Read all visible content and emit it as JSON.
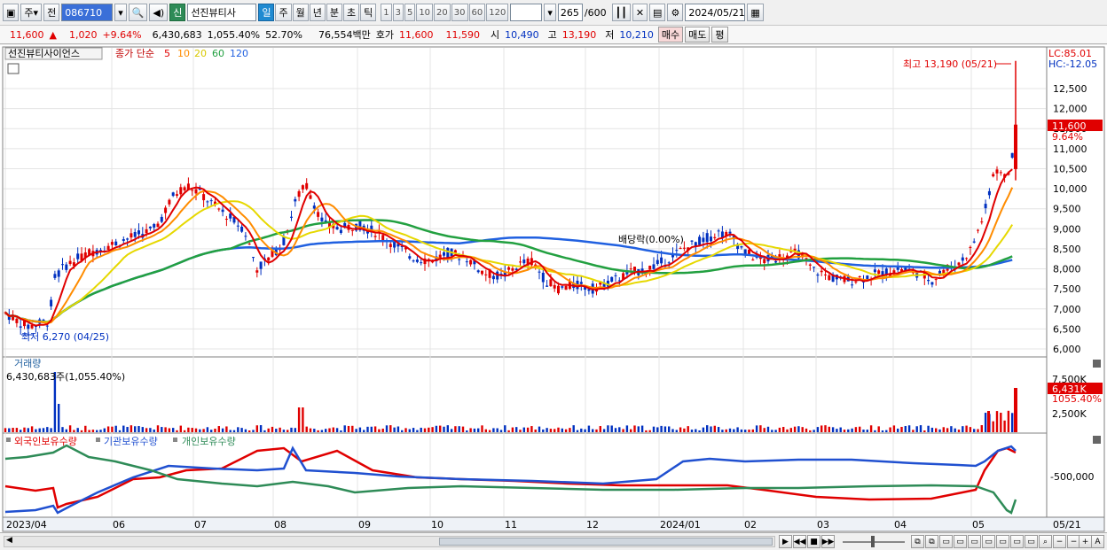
{
  "toolbar": {
    "market_type": "주",
    "prev_label": "전",
    "stock_code": "086710",
    "badge": "신",
    "stock_name": "선진뷰티사",
    "periods": [
      "일",
      "주",
      "월",
      "년",
      "분",
      "초",
      "틱"
    ],
    "active_period": "일",
    "intervals": [
      "1",
      "3",
      "5",
      "10",
      "20",
      "30",
      "60",
      "120"
    ],
    "count_value": "265",
    "count_total": "/600",
    "date_value": "2024/05/21"
  },
  "quote": {
    "price": "11,600",
    "arrow": "▲",
    "change": "1,020",
    "change_pct": "+9.64%",
    "volume": "6,430,683",
    "volume_pct": "1,055.40%",
    "turnover": "52.70%",
    "amount": "76,554백만",
    "ask_label": "호가",
    "ask": "11,600",
    "bid": "11,590",
    "open_label": "시",
    "open": "10,490",
    "high_label": "고",
    "high": "13,190",
    "low_label": "저",
    "low": "10,210",
    "buy_label": "매수",
    "sell_label": "매도",
    "eval_label": "평"
  },
  "price_panel": {
    "stock_title": "선진뷰티사이언스",
    "ma_title": "종가 단순",
    "ma_periods": [
      {
        "label": "5",
        "color": "#e00000"
      },
      {
        "label": "10",
        "color": "#ff8c00"
      },
      {
        "label": "20",
        "color": "#e6d800"
      },
      {
        "label": "60",
        "color": "#22a040"
      },
      {
        "label": "120",
        "color": "#2060e0"
      }
    ],
    "lc_label": "LC:85.01",
    "hc_label": "HC:-12.05",
    "high_annotation": "최고 13,190 (05/21)",
    "low_annotation": "최저 6,270 (04/25)",
    "dividend_annotation": "배당락(0.00%)",
    "current_price_tag": "11,600",
    "current_pct_tag": "9.64%",
    "y_ticks": [
      "12,500",
      "12,000",
      "11,500",
      "11,000",
      "10,500",
      "10,000",
      "9,500",
      "9,000",
      "8,500",
      "8,000",
      "7,500",
      "7,000",
      "6,500",
      "6,000"
    ]
  },
  "volume_panel": {
    "title": "거래량",
    "value_label": "6,430,683주(1,055.40%)",
    "y_ticks": [
      "7,500K",
      "5,000K",
      "2,500K"
    ],
    "current_tag": "6,431K",
    "current_pct": "1055.40%"
  },
  "holding_panel": {
    "series": [
      {
        "label": "외국인보유수량",
        "color": "#e00000"
      },
      {
        "label": "기관보유수량",
        "color": "#2050d0"
      },
      {
        "label": "개인보유수량",
        "color": "#2e8b57"
      }
    ],
    "y_tick": "-500,000"
  },
  "x_axis": {
    "labels": [
      "2023/04",
      "06",
      "07",
      "08",
      "09",
      "10",
      "11",
      "12",
      "2024/01",
      "02",
      "03",
      "04",
      "05"
    ],
    "right_label": "05/21"
  },
  "colors": {
    "up": "#e00000",
    "down": "#0030c0",
    "ma5": "#e00000",
    "ma10": "#ff8c00",
    "ma20": "#e6d800",
    "ma60": "#22a040",
    "ma120": "#2060e0"
  }
}
